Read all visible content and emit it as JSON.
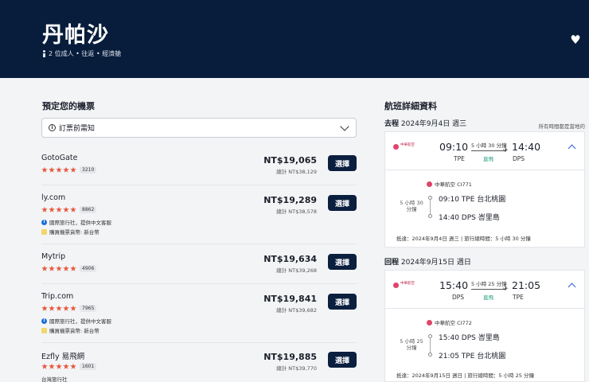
{
  "header": {
    "title": "丹帕沙",
    "subtitle": "2 位成人 • 往返 • 經濟艙"
  },
  "left": {
    "title": "預定您的機票",
    "notice_label": "訂票前需知",
    "select_label": "選擇",
    "agents": [
      {
        "name": "GotoGate",
        "reviews": "3210",
        "price": "NT$19,065",
        "total": "總計 NT$38,129",
        "notes": []
      },
      {
        "name": "ly.com",
        "reviews": "8862",
        "price": "NT$19,289",
        "total": "總計 NT$38,578",
        "notes": [
          {
            "type": "info",
            "text": "國際旅行社，提供中文客服"
          },
          {
            "type": "sq",
            "text": "購買機票貨幣: 新台幣"
          }
        ]
      },
      {
        "name": "Mytrip",
        "reviews": "4906",
        "price": "NT$19,634",
        "total": "總計 NT$39,268",
        "notes": []
      },
      {
        "name": "Trip.com",
        "reviews": "7965",
        "price": "NT$19,841",
        "total": "總計 NT$39,682",
        "notes": [
          {
            "type": "info",
            "text": "國際旅行社，提供中文客服"
          },
          {
            "type": "sq",
            "text": "購買機票貨幣: 新台幣"
          }
        ]
      },
      {
        "name": "Ezfly 易飛網",
        "reviews": "1601",
        "price": "NT$19,885",
        "total": "總計 NT$39,770",
        "notes": [
          {
            "type": "plain",
            "text": "台灣旅行社"
          }
        ]
      }
    ]
  },
  "right": {
    "title": "航班詳細資料",
    "tz_note": "所有時間都是當地的",
    "airline_logo_text": "中華航空",
    "outbound": {
      "label": "去程",
      "date": "2024年9月4日 週三",
      "dep_time": "09:10",
      "dep_code": "TPE",
      "arr_time": "14:40",
      "arr_code": "DPS",
      "duration": "5 小時 30 分鐘",
      "direct": "直飛",
      "flight": "中華航空 CI771",
      "v_duration": "5 小時 30 分鐘",
      "dep_detail": "09:10  TPE 台北桃園",
      "arr_detail": "14:40  DPS 峇里島",
      "info": "抵達：2024年9月4日 週三 | 旅行總時間：5 小時 30 分鐘"
    },
    "inbound": {
      "label": "回程",
      "date": "2024年9月15日 週日",
      "dep_time": "15:40",
      "dep_code": "DPS",
      "arr_time": "21:05",
      "arr_code": "TPE",
      "duration": "5 小時 25 分鐘",
      "direct": "直飛",
      "flight": "中華航空 CI772",
      "v_duration": "5 小時 25 分鐘",
      "dep_detail": "15:40  DPS 峇里島",
      "arr_detail": "21:05  TPE 台北桃園",
      "info": "抵達：2024年9月15日 週日 | 旅行總時間：5 小時 25 分鐘"
    }
  },
  "colors": {
    "header_bg": "#071d3b",
    "button_bg": "#0b1f3f",
    "star": "#e8553a",
    "accent_blue": "#2a5bd7"
  }
}
